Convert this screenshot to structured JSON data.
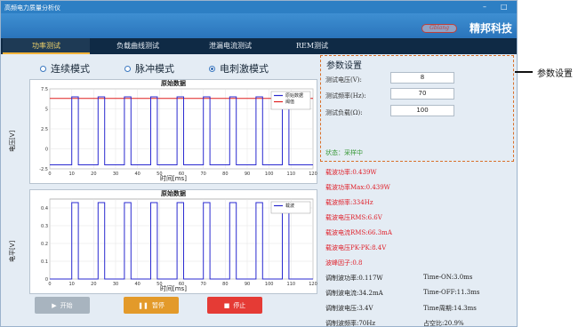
{
  "window": {
    "title": "高频电力质量分析仪",
    "controls": [
      "–",
      "□"
    ]
  },
  "brand": {
    "logo_text": "Gblang",
    "name": "精邦科技"
  },
  "tabs": [
    {
      "label": "功率测试",
      "active": true
    },
    {
      "label": "负载曲线测试",
      "active": false
    },
    {
      "label": "泄漏电流测试",
      "active": false
    },
    {
      "label": "REM测试",
      "active": false
    }
  ],
  "modes": [
    {
      "label": "连续模式",
      "selected": false
    },
    {
      "label": "脉冲模式",
      "selected": false
    },
    {
      "label": "电刺激模式",
      "selected": true
    }
  ],
  "chart_data": [
    {
      "type": "line",
      "title": "原始数据",
      "xlabel": "时间[ms]",
      "ylabel": "电压[V]",
      "xlim": [
        0,
        120
      ],
      "ylim": [
        -2.5,
        7.5
      ],
      "xticks": [
        0,
        10,
        20,
        30,
        40,
        50,
        60,
        70,
        80,
        90,
        100,
        110,
        120
      ],
      "yticks": [
        7.5,
        5,
        2.5,
        0,
        -2.5
      ],
      "legend": [
        "原始数据",
        "阈值"
      ],
      "legend_position": "top-right",
      "pulse_starts_ms": [
        10,
        22,
        34,
        46,
        58,
        70,
        82,
        94,
        106
      ],
      "pulse_width_ms": 3,
      "high_value": 6.5,
      "low_value": -2,
      "threshold": 6.3,
      "series_colors": [
        "#2a2ad0",
        "#e02020"
      ]
    },
    {
      "type": "line",
      "title": "原始数据",
      "xlabel": "时间[ms]",
      "ylabel": "电平[V]",
      "xlim": [
        0,
        120
      ],
      "ylim": [
        0,
        0.45
      ],
      "xticks": [
        0,
        10,
        20,
        30,
        40,
        50,
        60,
        70,
        80,
        90,
        100,
        110,
        120
      ],
      "yticks": [
        0.4,
        0.3,
        0.2,
        0.1,
        0
      ],
      "legend": [
        "载波"
      ],
      "legend_position": "top-right",
      "pulse_starts_ms": [
        10,
        22,
        34,
        46,
        58,
        70,
        82,
        94,
        106
      ],
      "pulse_width_ms": 3,
      "high_value": 0.43,
      "low_value": 0,
      "series_colors": [
        "#2a2ad0"
      ]
    }
  ],
  "buttons": [
    {
      "label": "开始",
      "icon": "play-icon",
      "color": "#a8b4bf"
    },
    {
      "label": "暂停",
      "icon": "pause-icon",
      "color": "#e39a2a"
    },
    {
      "label": "停止",
      "icon": "stop-icon",
      "color": "#e53b35"
    }
  ],
  "params": {
    "title": "参数设置",
    "voltage_label": "测试电压(V):",
    "voltage_value": "8",
    "freq_label": "测试频率(Hz):",
    "freq_value": "70",
    "load_label": "测试负载(Ω):",
    "load_value": "100",
    "status": "状态：采样中"
  },
  "measurements_red": [
    "载波功率:0.439W",
    "载波功率Max:0.439W",
    "载波频率:334Hz",
    "载波电压RMS:6.6V",
    "载波电流RMS:66.3mA",
    "载波电压PK-PK:8.4V",
    "波峰因子:0.8"
  ],
  "measurements_left": [
    "调制波功率:0.117W",
    "调制波电流:34.2mA",
    "调制波电压:3.4V",
    "调制波频率:70Hz"
  ],
  "measurements_right": [
    "Time-ON:3.0ms",
    "Time-OFF:11.3ms",
    "Time周期:14.3ms",
    "占空比:20.9%"
  ],
  "annotation": {
    "label": "参数设置"
  }
}
